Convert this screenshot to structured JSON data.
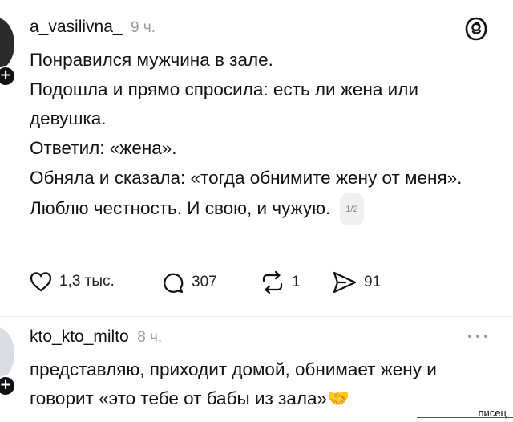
{
  "post1": {
    "username": "a_vasilivna_",
    "time": "9 ч.",
    "lines": [
      "Понравился мужчина в зале.",
      "Подошла и прямо спросила: есть ли жена или девушка.",
      "Ответил: «жена».",
      "Обняла и сказала: «тогда обнимите жену от меня».",
      "Люблю честность. И свою, и чужую."
    ],
    "page_indicator": "1/2",
    "actions": {
      "likes": "1,3 тыс.",
      "comments": "307",
      "reposts": "1",
      "shares": "91"
    }
  },
  "post2": {
    "username": "kto_kto_milto",
    "time": "8 ч.",
    "text": "представляю, приходит домой, обнимает жену и говорит «это тебе от бабы из зала»",
    "emoji": "🤝"
  },
  "watermark": "писец"
}
